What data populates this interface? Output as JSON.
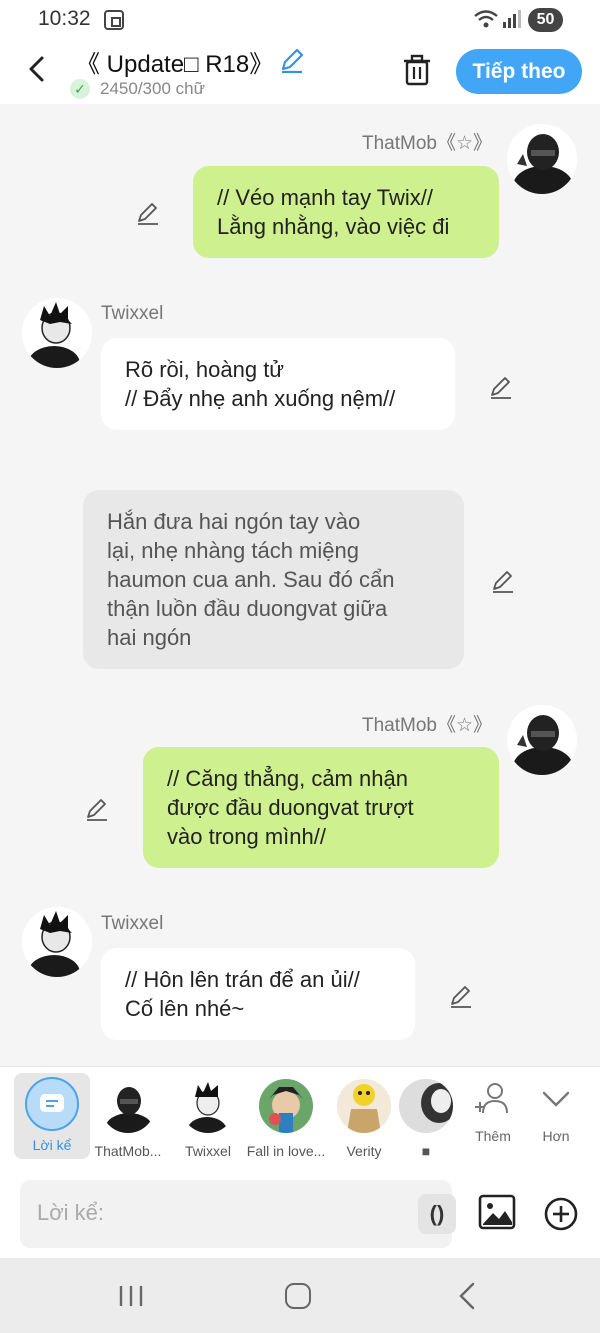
{
  "status_bar": {
    "time": "10:32",
    "battery": "50"
  },
  "header": {
    "title": "《 Update□ R18》",
    "word_count": "2450/300 chữ",
    "next_label": "Tiếp theo"
  },
  "messages": [
    {
      "sender": "ThatMob《☆》",
      "side": "right",
      "style": "green",
      "lines": [
        "// Véo mạnh tay Twix//",
        "Lằng nhằng, vào việc đi"
      ]
    },
    {
      "sender": "Twixxel",
      "side": "left",
      "style": "white",
      "lines": [
        "Rõ rồi, hoàng tử",
        "// Đẩy nhẹ anh xuống nệm//"
      ]
    },
    {
      "sender": "",
      "side": "narration",
      "style": "gray",
      "lines": [
        "Hắn đưa hai ngón tay vào",
        "lại, nhẹ nhàng tách miệng",
        "haumon cua anh. Sau đó cẩn",
        "thận luồn đầu duongvat giữa",
        "hai ngón"
      ]
    },
    {
      "sender": "ThatMob《☆》",
      "side": "right",
      "style": "green",
      "lines": [
        "// Căng thẳng, cảm nhận",
        "được đầu duongvat trượt",
        "vào trong mình//"
      ]
    },
    {
      "sender": "Twixxel",
      "side": "left",
      "style": "white",
      "lines": [
        "// Hôn lên trán để an ủi//",
        "Cố lên nhé~"
      ]
    }
  ],
  "characters": [
    {
      "label": "Lời kể",
      "icon": "narration-icon",
      "selected": true
    },
    {
      "label": "ThatMob..."
    },
    {
      "label": "Twixxel"
    },
    {
      "label": "Fall in love..."
    },
    {
      "label": "Verity"
    },
    {
      "label": "■"
    }
  ],
  "char_actions": {
    "add_label": "Thêm",
    "more_label": "Hơn"
  },
  "composer": {
    "placeholder": "Lời kể:",
    "paren_label": "()"
  },
  "colors": {
    "accent": "#42a5f5",
    "own_bubble": "#cff08f",
    "narration_bubble": "#e8e8e8"
  }
}
